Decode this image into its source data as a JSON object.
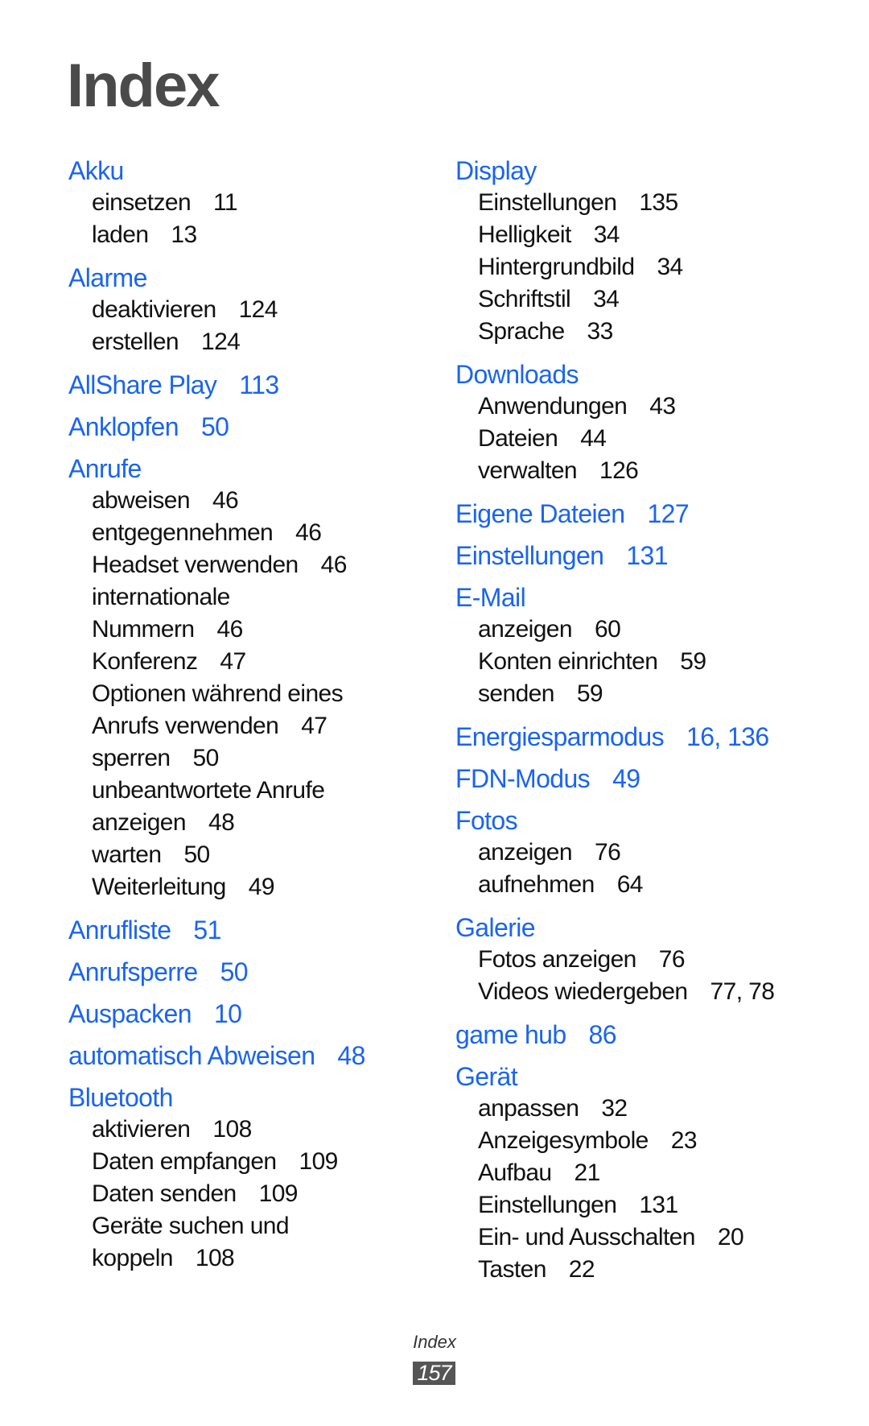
{
  "page": {
    "title": "Index",
    "footer_label": "Index",
    "page_number": "157",
    "colors": {
      "heading": "#1a64f0",
      "title": "#4a4a4a",
      "text": "#111111",
      "page_badge": "#555555"
    }
  },
  "left_column": [
    {
      "term": "Akku",
      "pages": "",
      "subs": [
        {
          "lines": [
            "einsetzen"
          ],
          "pages": "11"
        },
        {
          "lines": [
            "laden"
          ],
          "pages": "13"
        }
      ]
    },
    {
      "term": "Alarme",
      "pages": "",
      "subs": [
        {
          "lines": [
            "deaktivieren"
          ],
          "pages": "124"
        },
        {
          "lines": [
            "erstellen"
          ],
          "pages": "124"
        }
      ]
    },
    {
      "term": "AllShare Play",
      "pages": "113",
      "subs": []
    },
    {
      "term": "Anklopfen",
      "pages": "50",
      "subs": []
    },
    {
      "term": "Anrufe",
      "pages": "",
      "subs": [
        {
          "lines": [
            "abweisen"
          ],
          "pages": "46"
        },
        {
          "lines": [
            "entgegennehmen"
          ],
          "pages": "46"
        },
        {
          "lines": [
            "Headset verwenden"
          ],
          "pages": "46"
        },
        {
          "lines": [
            "internationale",
            "Nummern"
          ],
          "pages": "46"
        },
        {
          "lines": [
            "Konferenz"
          ],
          "pages": "47"
        },
        {
          "lines": [
            "Optionen während eines",
            "Anrufs verwenden"
          ],
          "pages": "47"
        },
        {
          "lines": [
            "sperren"
          ],
          "pages": "50"
        },
        {
          "lines": [
            "unbeantwortete Anrufe",
            "anzeigen"
          ],
          "pages": "48"
        },
        {
          "lines": [
            "warten"
          ],
          "pages": "50"
        },
        {
          "lines": [
            "Weiterleitung"
          ],
          "pages": "49"
        }
      ]
    },
    {
      "term": "Anrufliste",
      "pages": "51",
      "subs": []
    },
    {
      "term": "Anrufsperre",
      "pages": "50",
      "subs": []
    },
    {
      "term": "Auspacken",
      "pages": "10",
      "subs": []
    },
    {
      "term": "automatisch Abweisen",
      "pages": "48",
      "subs": []
    },
    {
      "term": "Bluetooth",
      "pages": "",
      "subs": [
        {
          "lines": [
            "aktivieren"
          ],
          "pages": "108"
        },
        {
          "lines": [
            "Daten empfangen"
          ],
          "pages": "109"
        },
        {
          "lines": [
            "Daten senden"
          ],
          "pages": "109"
        },
        {
          "lines": [
            "Geräte suchen und",
            "koppeln"
          ],
          "pages": "108"
        }
      ]
    }
  ],
  "right_column": [
    {
      "term": "Display",
      "pages": "",
      "subs": [
        {
          "lines": [
            "Einstellungen"
          ],
          "pages": "135"
        },
        {
          "lines": [
            "Helligkeit"
          ],
          "pages": "34"
        },
        {
          "lines": [
            "Hintergrundbild"
          ],
          "pages": "34"
        },
        {
          "lines": [
            "Schriftstil"
          ],
          "pages": "34"
        },
        {
          "lines": [
            "Sprache"
          ],
          "pages": "33"
        }
      ]
    },
    {
      "term": "Downloads",
      "pages": "",
      "subs": [
        {
          "lines": [
            "Anwendungen"
          ],
          "pages": "43"
        },
        {
          "lines": [
            "Dateien"
          ],
          "pages": "44"
        },
        {
          "lines": [
            "verwalten"
          ],
          "pages": "126"
        }
      ]
    },
    {
      "term": "Eigene Dateien",
      "pages": "127",
      "subs": []
    },
    {
      "term": "Einstellungen",
      "pages": "131",
      "subs": []
    },
    {
      "term": "E-Mail",
      "pages": "",
      "subs": [
        {
          "lines": [
            "anzeigen"
          ],
          "pages": "60"
        },
        {
          "lines": [
            "Konten einrichten"
          ],
          "pages": "59"
        },
        {
          "lines": [
            "senden"
          ],
          "pages": "59"
        }
      ]
    },
    {
      "term": "Energiesparmodus",
      "pages": "16, 136",
      "subs": []
    },
    {
      "term": "FDN-Modus",
      "pages": "49",
      "subs": []
    },
    {
      "term": "Fotos",
      "pages": "",
      "subs": [
        {
          "lines": [
            "anzeigen"
          ],
          "pages": "76"
        },
        {
          "lines": [
            "aufnehmen"
          ],
          "pages": "64"
        }
      ]
    },
    {
      "term": "Galerie",
      "pages": "",
      "subs": [
        {
          "lines": [
            "Fotos anzeigen"
          ],
          "pages": "76"
        },
        {
          "lines": [
            "Videos wiedergeben"
          ],
          "pages": "77, 78"
        }
      ]
    },
    {
      "term": "game hub",
      "pages": "86",
      "subs": []
    },
    {
      "term": "Gerät",
      "pages": "",
      "subs": [
        {
          "lines": [
            "anpassen"
          ],
          "pages": "32"
        },
        {
          "lines": [
            "Anzeigesymbole"
          ],
          "pages": "23"
        },
        {
          "lines": [
            "Aufbau"
          ],
          "pages": "21"
        },
        {
          "lines": [
            "Einstellungen"
          ],
          "pages": "131"
        },
        {
          "lines": [
            "Ein- und Ausschalten"
          ],
          "pages": "20"
        },
        {
          "lines": [
            "Tasten"
          ],
          "pages": "22"
        }
      ]
    }
  ]
}
